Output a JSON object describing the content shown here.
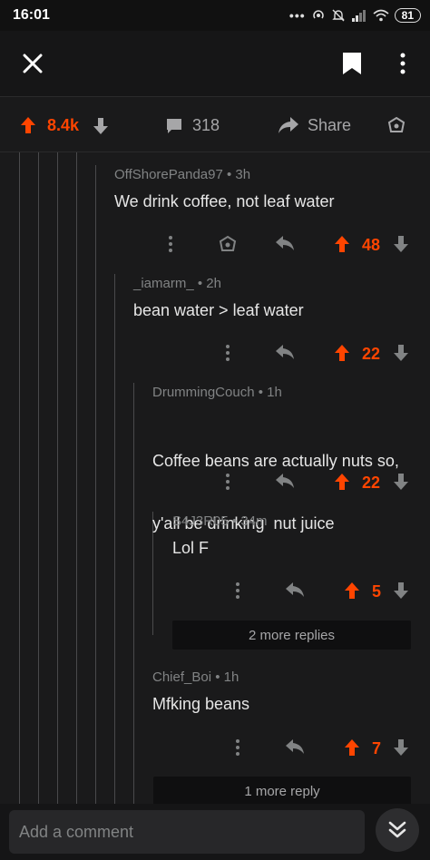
{
  "status_bar": {
    "time": "16:01",
    "battery": "81"
  },
  "post_actions": {
    "score": "8.4k",
    "comment_count": "318",
    "share_label": "Share"
  },
  "comments": [
    {
      "author": "OffShorePanda97",
      "age": "3h",
      "body": "We drink coffee, not leaf water",
      "score": "48"
    },
    {
      "author": "_iamarm_",
      "age": "2h",
      "body": "bean water > leaf water",
      "score": "22"
    },
    {
      "author": "DrummingCouch",
      "age": "1h",
      "body_lines": [
        "Coffee beans are actually nuts so,",
        "y'all be drinking  nut juice"
      ],
      "score": "22"
    },
    {
      "author": "S4J3R05",
      "age": "34m",
      "body": "Lol F",
      "score": "5"
    },
    {
      "author": "Chief_Boi",
      "age": "1h",
      "body": "Mfking beans",
      "score": "7"
    }
  ],
  "more_replies": [
    "2 more replies",
    "1 more reply"
  ],
  "composer": {
    "placeholder": "Add a comment"
  },
  "colors": {
    "upvote": "#ff4500",
    "background": "#1a1a1b"
  },
  "icons": [
    "close-icon",
    "bookmark-icon",
    "more-vertical-icon",
    "upvote-icon",
    "downvote-icon",
    "comment-icon",
    "share-icon",
    "award-icon",
    "reply-icon",
    "collapse-icon"
  ]
}
